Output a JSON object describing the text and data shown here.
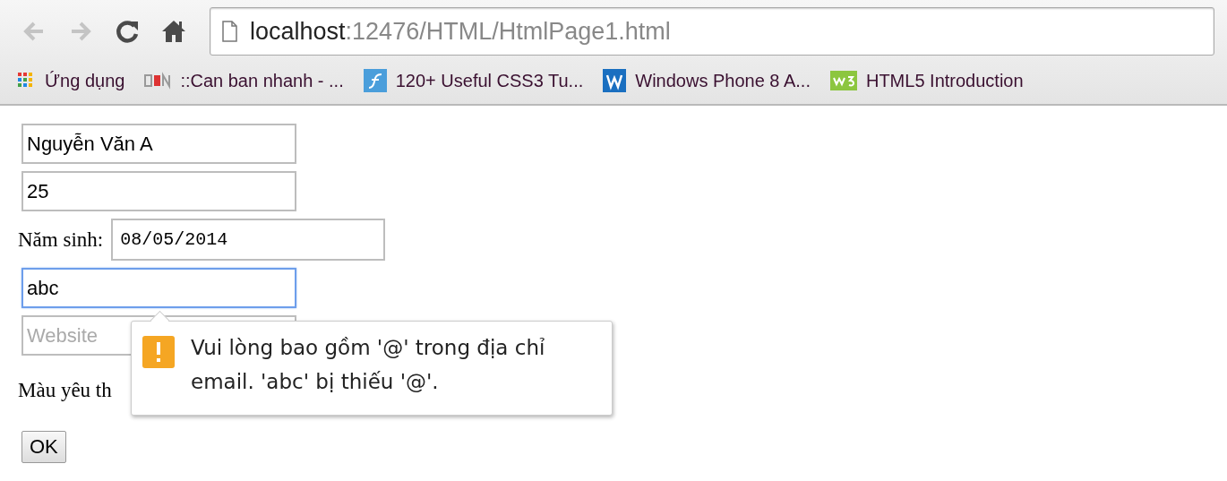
{
  "toolbar": {
    "buttons": [
      {
        "kind": "back",
        "disabled": true
      },
      {
        "kind": "forward",
        "disabled": true
      },
      {
        "kind": "reload",
        "disabled": false
      },
      {
        "kind": "home",
        "disabled": false
      }
    ],
    "address": {
      "host": "localhost",
      "path": ":12476/HTML/HtmlPage1.html"
    }
  },
  "bookmarks": [
    {
      "kind": "apps",
      "label": "Ứng dụng"
    },
    {
      "kind": "cbn",
      "label": "::Can ban nhanh - ..."
    },
    {
      "kind": "flash",
      "label": "120+ Useful CSS3 Tu..."
    },
    {
      "kind": "word",
      "label": "Windows Phone 8 A..."
    },
    {
      "kind": "w3",
      "label": "HTML5 Introduction"
    }
  ],
  "form": {
    "fields": [
      {
        "kind": "text",
        "value": "Nguyễn Văn A",
        "focused": false
      },
      {
        "kind": "text",
        "value": "25",
        "focused": false
      },
      {
        "kind": "date",
        "label": "Năm sinh:",
        "value": "08/05/2014",
        "focused": false
      },
      {
        "kind": "text",
        "value": "abc",
        "focused": true
      },
      {
        "kind": "text",
        "placeholder": "Website",
        "focused": false
      }
    ],
    "color_label": "Màu yêu th",
    "submit": "OK"
  },
  "validation_tooltip": {
    "message": "Vui lòng bao gồm '@' trong địa chỉ email. 'abc' bị thiếu '@'."
  }
}
